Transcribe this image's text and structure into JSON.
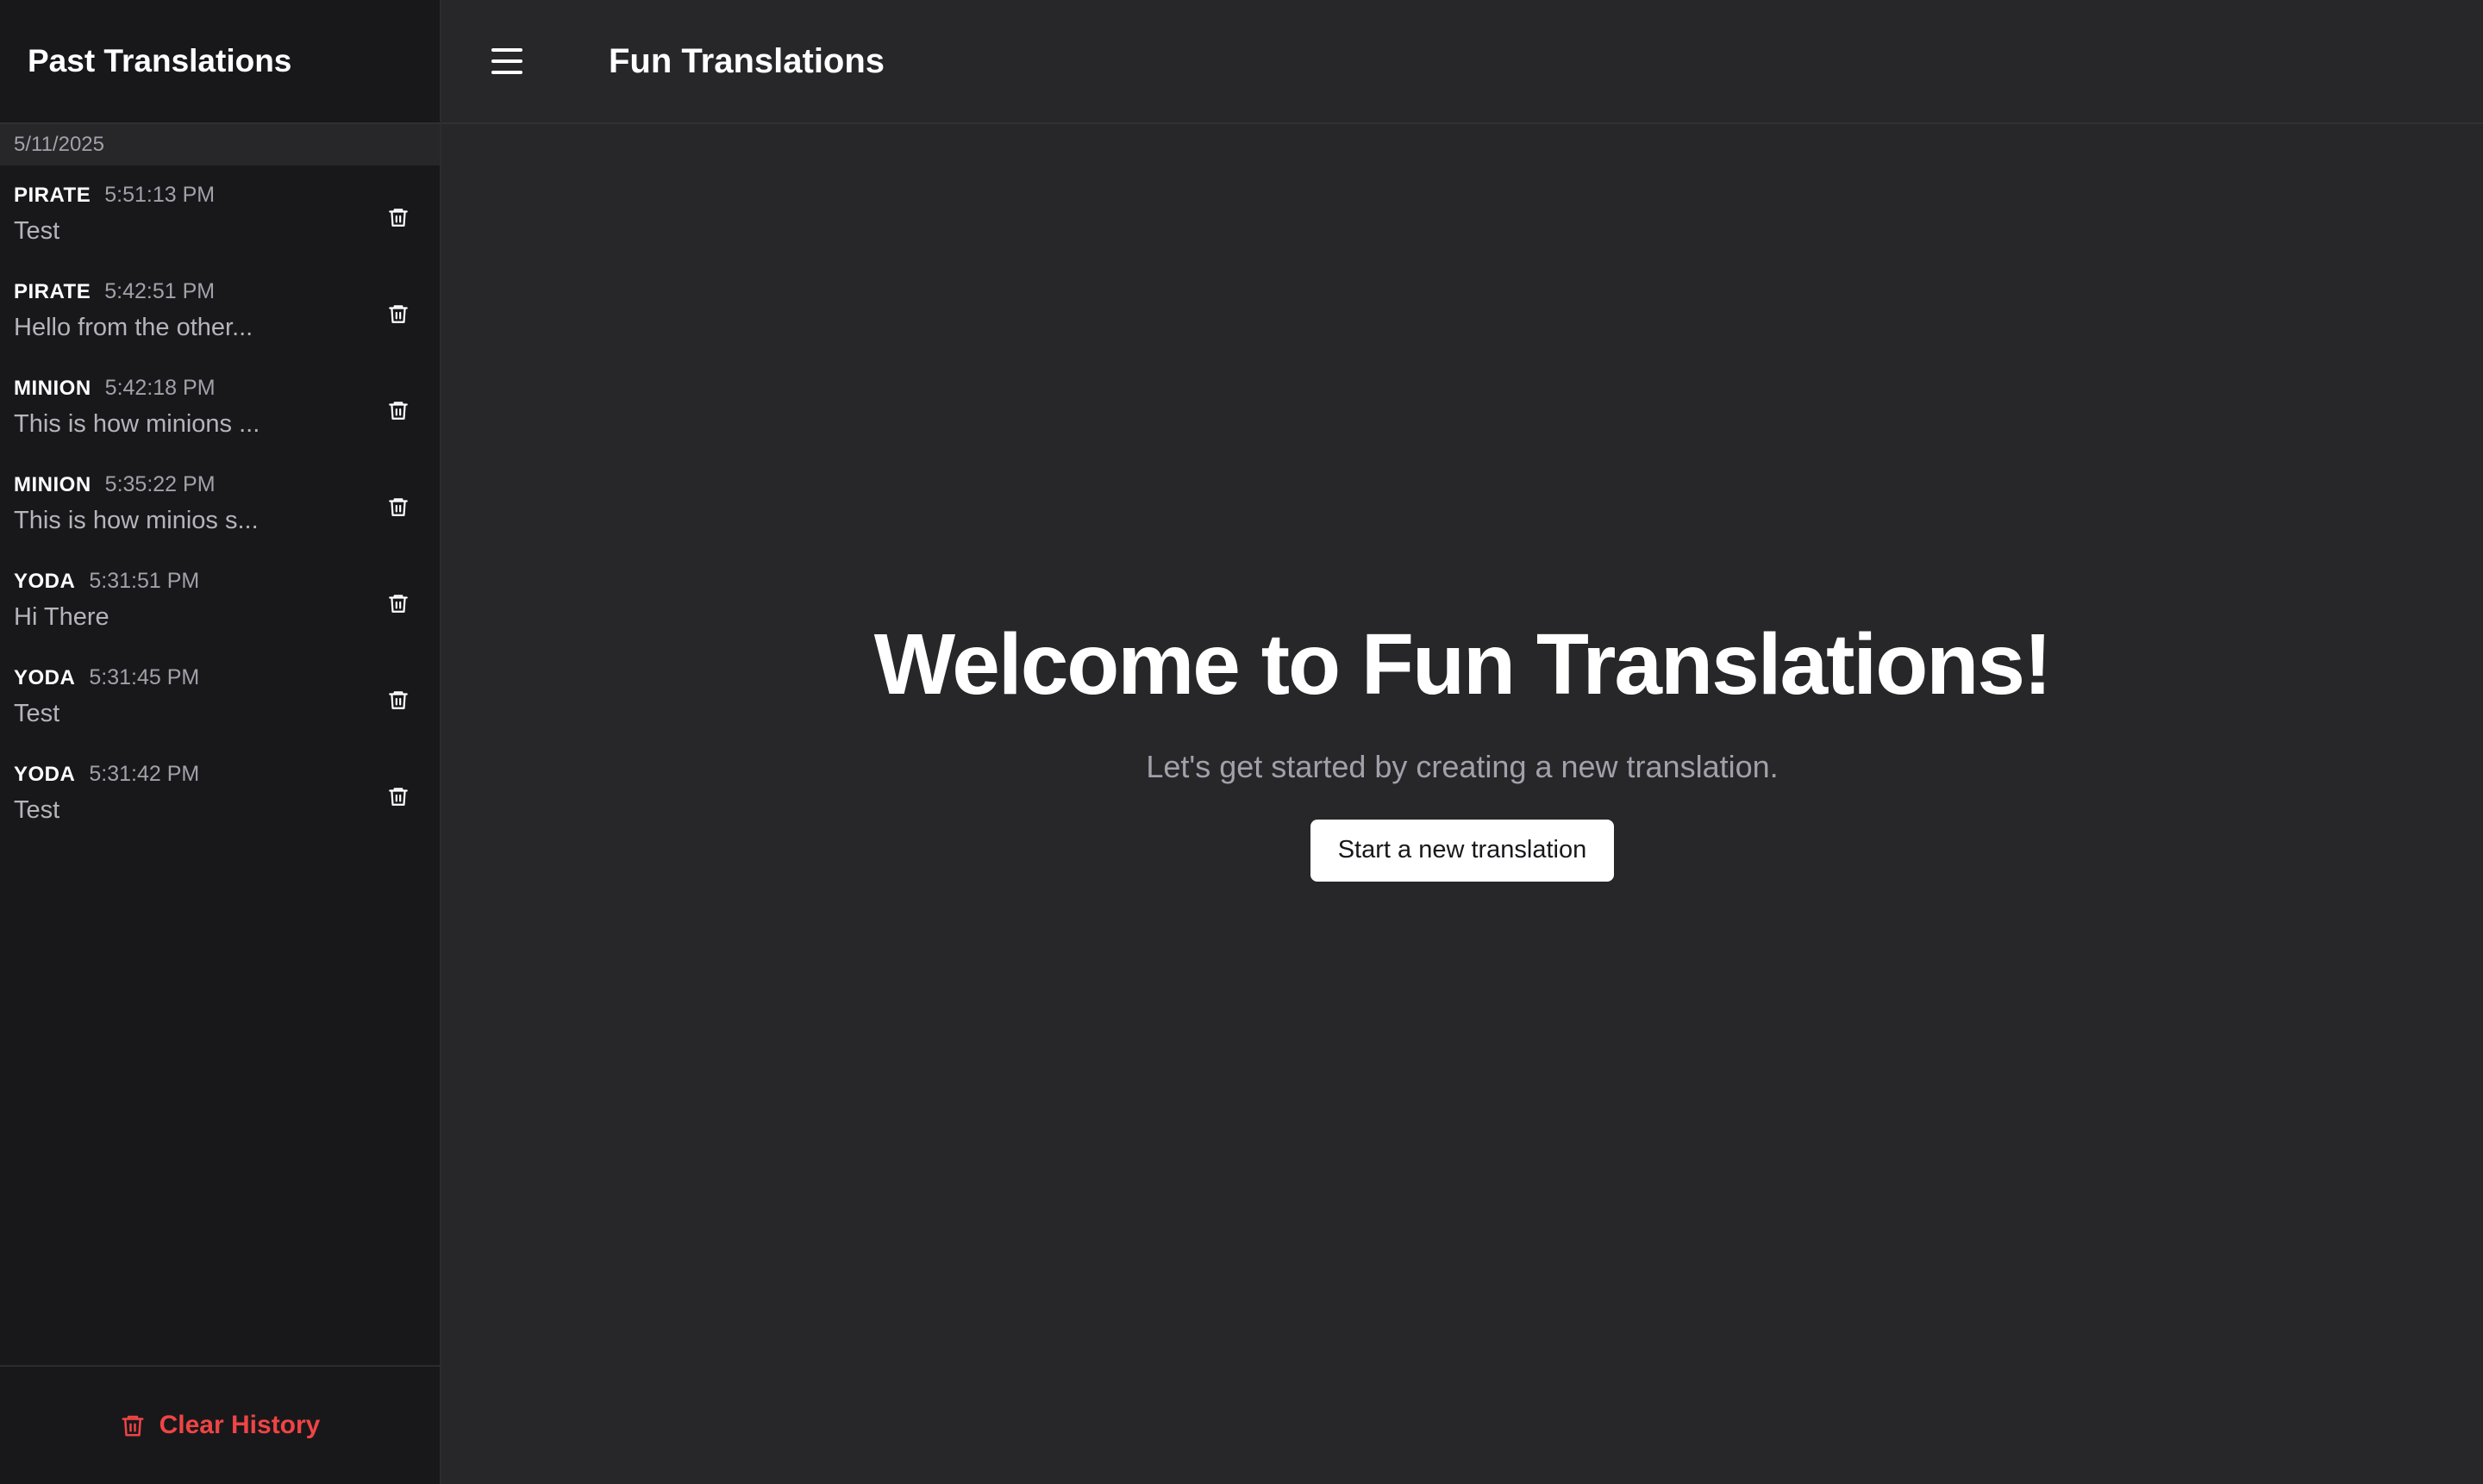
{
  "sidebar": {
    "title": "Past Translations",
    "date_group": "5/11/2025",
    "items": [
      {
        "lang": "PIRATE",
        "time": "5:51:13 PM",
        "text": "Test"
      },
      {
        "lang": "PIRATE",
        "time": "5:42:51 PM",
        "text": "Hello from the other..."
      },
      {
        "lang": "MINION",
        "time": "5:42:18 PM",
        "text": "This is how minions ..."
      },
      {
        "lang": "MINION",
        "time": "5:35:22 PM",
        "text": "This is how minios s..."
      },
      {
        "lang": "YODA",
        "time": "5:31:51 PM",
        "text": "Hi There"
      },
      {
        "lang": "YODA",
        "time": "5:31:45 PM",
        "text": "Test"
      },
      {
        "lang": "YODA",
        "time": "5:31:42 PM",
        "text": "Test"
      }
    ],
    "clear_label": "Clear History"
  },
  "header": {
    "app_title": "Fun Translations"
  },
  "main": {
    "welcome_title": "Welcome to Fun Translations!",
    "welcome_subtitle": "Let's get started by creating a new translation.",
    "start_button": "Start a new translation"
  },
  "icons": {
    "menu": "hamburger-menu-icon",
    "delete": "trash-icon"
  },
  "colors": {
    "background": "#27272a",
    "sidebar": "#18181b",
    "danger": "#ef4444",
    "button_bg": "#ffffff"
  }
}
